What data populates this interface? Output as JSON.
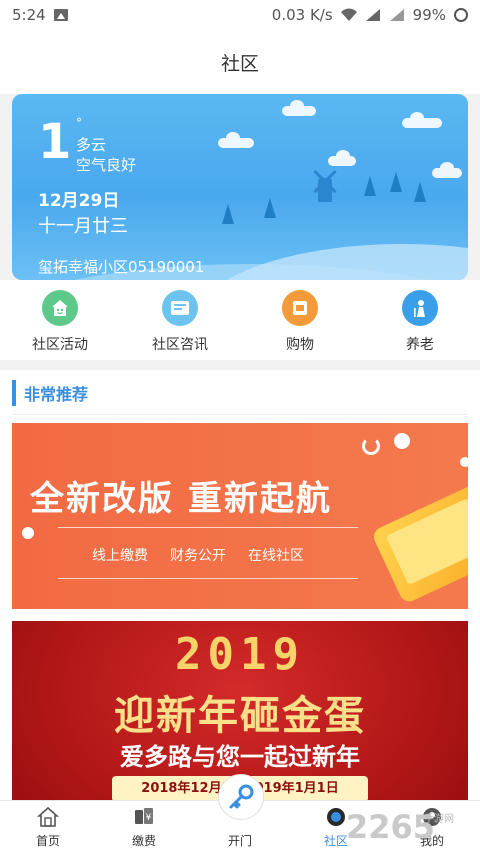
{
  "statusbar": {
    "time": "5:24",
    "speed": "0.03 K/s",
    "battery": "99%"
  },
  "appbar": {
    "title": "社区"
  },
  "weather": {
    "temperature": "1",
    "degree_mark": "°",
    "condition": "多云",
    "air_quality": "空气良好",
    "date": "12月29日",
    "lunar_date": "十一月廿三",
    "community": "玺拓幸福小区05190001"
  },
  "menu": [
    {
      "label": "社区活动",
      "icon": "smile-icon",
      "color": "#5cc98a"
    },
    {
      "label": "社区咨讯",
      "icon": "news-icon",
      "color": "#6cc3ee"
    },
    {
      "label": "购物",
      "icon": "shopping-icon",
      "color": "#f39a3a"
    },
    {
      "label": "养老",
      "icon": "elderly-icon",
      "color": "#3a9ee8"
    }
  ],
  "section": {
    "title": "非常推荐"
  },
  "banner1": {
    "headline": "全新改版 重新起航",
    "tags": [
      "线上缴费",
      "财务公开",
      "在线社区"
    ],
    "bg": "#f26a43"
  },
  "banner2": {
    "year": "2019",
    "title": "迎新年砸金蛋",
    "subtitle": "爱多路与您一起过新年",
    "date_range": "2018年12月3...2019年1月1日",
    "bg": "#b01616"
  },
  "tabbar": {
    "items": [
      {
        "label": "首页",
        "icon": "home-icon"
      },
      {
        "label": "缴费",
        "icon": "payment-icon"
      },
      {
        "label": "开门",
        "icon": "key-icon"
      },
      {
        "label": "社区",
        "icon": "community-icon",
        "active": true
      },
      {
        "label": "我的",
        "icon": "profile-icon"
      }
    ]
  },
  "watermark": {
    "number": "2265",
    "site": "手游网"
  }
}
